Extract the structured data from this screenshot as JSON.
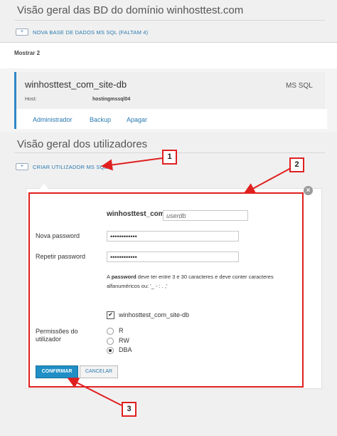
{
  "overview": {
    "title": "Visão geral das BD do domínio winhosttest.com",
    "add_db_label": "NOVA BASE DE DADOS MS SQL (FALTAM 4)",
    "plus_symbol": "+",
    "show_label": "Mostrar 2"
  },
  "database": {
    "name": "winhosttest_com_site-db",
    "type": "MS SQL",
    "host_label": "Host:",
    "host_value": "hostingmssql04",
    "actions": [
      "Administrador",
      "Backup",
      "Apagar"
    ]
  },
  "users": {
    "title": "Visão geral dos utilizadores",
    "create_label": "CRIAR UTILIZADOR MS SQL"
  },
  "form": {
    "username_prefix": "winhosttest_com_",
    "username_placeholder": "userdb",
    "password_label": "Nova password",
    "password_value": "••••••••••••",
    "repeat_label": "Repetir password",
    "repeat_value": "••••••••••••",
    "hint_pre": "A ",
    "hint_bold": "password",
    "hint_post": " deve ter entre 3 e 30 caracteres e deve conter caracteres alfanuméricos ou: '_ - : . ,'",
    "db_checkbox_label": "winhosttest_com_site-db",
    "permissions_label": "Permissões do utilizador",
    "permissions": [
      {
        "label": "R",
        "selected": false
      },
      {
        "label": "RW",
        "selected": false
      },
      {
        "label": "DBA",
        "selected": true
      }
    ],
    "confirm_label": "CONFIRMAR",
    "cancel_label": "CANCELAR",
    "close_symbol": "×"
  },
  "annotations": {
    "badges": [
      "1",
      "2",
      "3"
    ],
    "color": "#e02020"
  },
  "colors": {
    "accent": "#2e88c7",
    "link": "#2a7ab0",
    "confirm": "#1f8fc6"
  }
}
